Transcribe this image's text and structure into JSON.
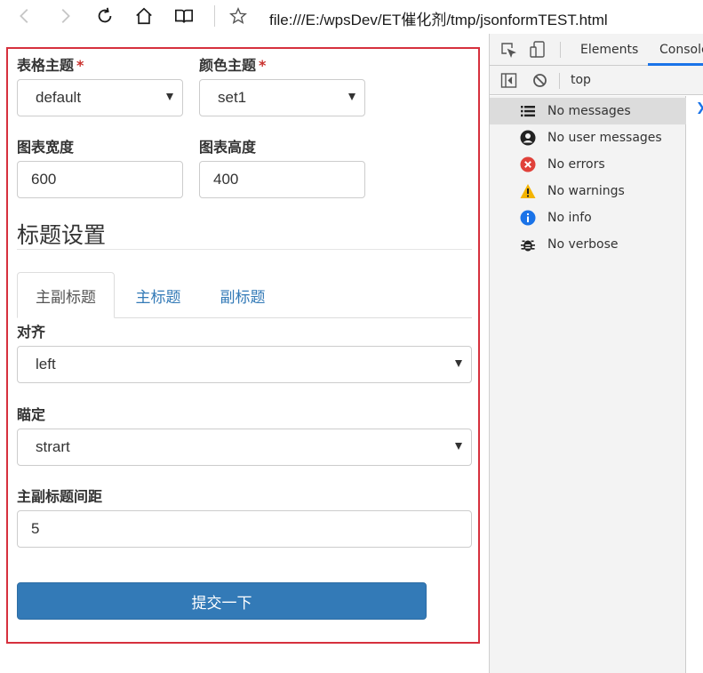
{
  "browser": {
    "url": "file:///E:/wpsDev/ET催化剂/tmp/jsonformTEST.html"
  },
  "form": {
    "table_theme": {
      "label": "表格主题",
      "required_mark": "*",
      "value": "default"
    },
    "color_theme": {
      "label": "颜色主题",
      "required_mark": "*",
      "value": "set1"
    },
    "chart_width": {
      "label": "图表宽度",
      "value": "600"
    },
    "chart_height": {
      "label": "图表高度",
      "value": "400"
    },
    "section_title": "标题设置",
    "tabs": [
      {
        "label": "主副标题",
        "active": true
      },
      {
        "label": "主标题",
        "active": false
      },
      {
        "label": "副标题",
        "active": false
      }
    ],
    "align": {
      "label": "对齐",
      "value": "left"
    },
    "anchor": {
      "label": "瞄定",
      "value": "strart"
    },
    "spacing": {
      "label": "主副标题间距",
      "value": "5"
    },
    "submit_label": "提交一下"
  },
  "devtools": {
    "tabs": [
      {
        "label": "Elements"
      },
      {
        "label": "Console",
        "active": true
      }
    ],
    "context": "top",
    "sidebar_items": [
      {
        "label": "No messages",
        "icon": "list-icon",
        "selected": true
      },
      {
        "label": "No user messages",
        "icon": "user-icon"
      },
      {
        "label": "No errors",
        "icon": "error-icon",
        "color": "#e0413a"
      },
      {
        "label": "No warnings",
        "icon": "warning-icon",
        "color": "#f4b400"
      },
      {
        "label": "No info",
        "icon": "info-icon",
        "color": "#1a73e8"
      },
      {
        "label": "No verbose",
        "icon": "bug-icon"
      }
    ]
  },
  "colors": {
    "frame_border": "#d6303d",
    "primary_button": "#337ab7",
    "link": "#337ab7",
    "devtools_accent": "#1a73e8"
  }
}
